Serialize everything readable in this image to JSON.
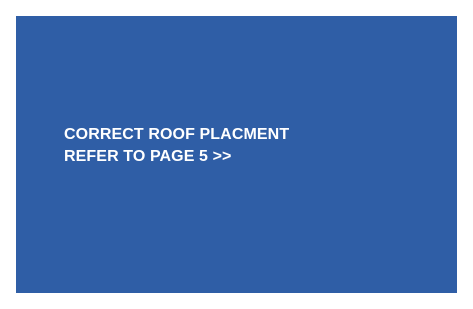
{
  "callout": {
    "line1": "CORRECT ROOF PLACMENT",
    "line2": "REFER TO PAGE 5 >>"
  },
  "colors": {
    "panel_background": "#2f5ea6",
    "text": "#ffffff",
    "page_background": "#ffffff"
  }
}
